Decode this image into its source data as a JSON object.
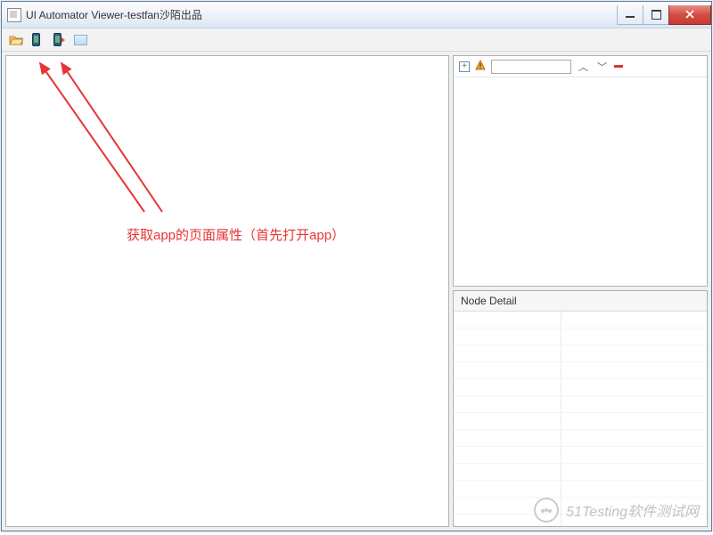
{
  "window": {
    "title": "UI Automator Viewer-testfan沙陌出品"
  },
  "annotation": {
    "text": "获取app的页面属性（首先打开app）"
  },
  "right_panel": {
    "detail_header": "Node Detail"
  },
  "watermark": {
    "text": "51Testing软件测试网"
  },
  "toolbar": {
    "icons": [
      "open-folder",
      "device-screenshot-1",
      "device-screenshot-2",
      "blank-view"
    ]
  },
  "tree_toolbar": {
    "search_value": ""
  },
  "colors": {
    "annotation": "#e63535",
    "titlebar_border": "#5a7ca0",
    "close_btn": "#c93a2f"
  }
}
